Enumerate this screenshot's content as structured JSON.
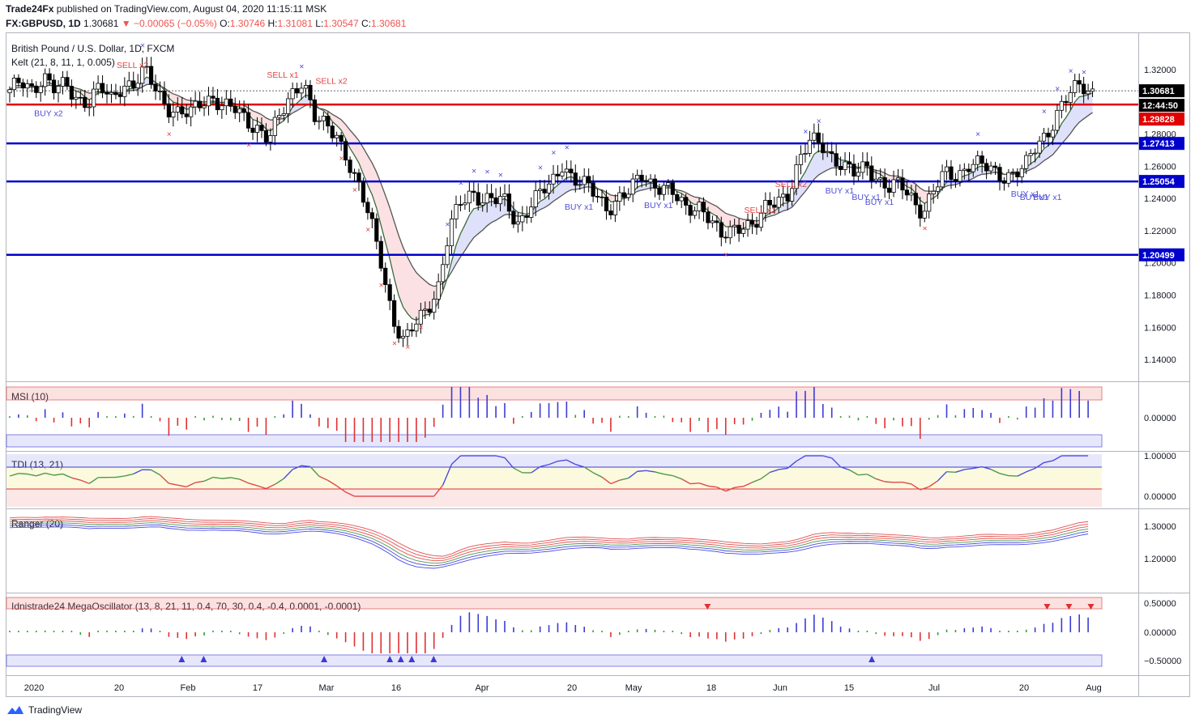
{
  "header": {
    "publisher": "Trade24Fx",
    "published_text": "published on TradingView.com, August 04, 2020 11:15:11 MSK",
    "symbol": "FX:GBPUSD, 1D",
    "last": "1.30681",
    "change": "−0.00065 (−0.05%)",
    "o_label": "O:",
    "o": "1.30746",
    "h_label": "H:",
    "h": "1.31081",
    "l_label": "L:",
    "l": "1.30547",
    "c_label": "C:",
    "c": "1.30681"
  },
  "pane_titles": {
    "main": "British Pound / U.S. Dollar, 1D, FXCM",
    "keltner": "Kelt (21, 8, 11, 1, 0.005)",
    "msi": "MSI (10)",
    "tdi": "TDI (13, 21)",
    "ranger": "Ranger (20)",
    "mega": "Idnistrade24 MegaOscillator (13, 8, 21, 11, 0.4, 70, 30, 0.4, -0.4, 0.0001, -0.0001)"
  },
  "price_badges": {
    "last": "1.30681",
    "countdown": "12:44:50",
    "red_level": "1.29828",
    "level1": "1.27413",
    "level2": "1.25054",
    "level3": "1.20499"
  },
  "colors": {
    "up": "#ffffff",
    "down": "#000000",
    "level_blue": "#0000cc",
    "level_red": "#e00000",
    "buy": "#4f4fd6",
    "sell": "#e04545",
    "grid_text": "#131722"
  },
  "chart_data": {
    "type": "candlestick",
    "title": "British Pound / U.S. Dollar, 1D, FXCM",
    "price_axis": {
      "ticks": [
        1.32,
        1.3,
        1.28,
        1.26,
        1.24,
        1.22,
        1.2,
        1.18,
        1.16,
        1.14
      ],
      "range": [
        1.128,
        1.334
      ]
    },
    "x_ticks": [
      "2020",
      "20",
      "Feb",
      "17",
      "Mar",
      "16",
      "Apr",
      "20",
      "May",
      "18",
      "Jun",
      "15",
      "Jul",
      "20",
      "Aug"
    ],
    "horizontal_levels": [
      {
        "value": 1.29828,
        "color": "red"
      },
      {
        "value": 1.27413,
        "color": "blue"
      },
      {
        "value": 1.25054,
        "color": "blue"
      },
      {
        "value": 1.20499,
        "color": "blue"
      }
    ],
    "close_path": [
      1.305,
      1.312,
      1.309,
      1.316,
      1.306,
      1.31,
      1.303,
      1.3,
      1.308,
      1.301,
      1.312,
      1.311,
      1.318,
      1.307,
      1.298,
      1.293,
      1.291,
      1.3,
      1.304,
      1.297,
      1.294,
      1.288,
      1.285,
      1.277,
      1.29,
      1.305,
      1.316,
      1.29,
      1.283,
      1.28,
      1.265,
      1.245,
      1.225,
      1.2,
      1.165,
      1.149,
      1.162,
      1.173,
      1.186,
      1.22,
      1.237,
      1.245,
      1.24,
      1.238,
      1.237,
      1.225,
      1.235,
      1.242,
      1.248,
      1.263,
      1.252,
      1.247,
      1.242,
      1.235,
      1.24,
      1.243,
      1.255,
      1.25,
      1.247,
      1.24,
      1.233,
      1.238,
      1.228,
      1.214,
      1.221,
      1.226,
      1.222,
      1.232,
      1.24,
      1.244,
      1.262,
      1.275,
      1.275,
      1.266,
      1.258,
      1.254,
      1.262,
      1.252,
      1.245,
      1.248,
      1.241,
      1.232,
      1.245,
      1.255,
      1.255,
      1.262,
      1.26,
      1.257,
      1.255,
      1.256,
      1.258,
      1.272,
      1.282,
      1.295,
      1.304,
      1.31,
      1.307
    ],
    "candles_per_day": 6,
    "indicators": {
      "msi": {
        "ticks": [
          "0.00000"
        ]
      },
      "tdi": {
        "ticks": [
          "1.00000",
          "0.00000"
        ]
      },
      "ranger": {
        "ticks": [
          "1.30000",
          "1.20000"
        ]
      },
      "mega": {
        "ticks": [
          "0.50000",
          "0.00000",
          "−0.50000"
        ]
      }
    }
  },
  "signals": {
    "buy": [
      "BUY x2",
      "BUY x1",
      "BUY x1",
      "BUY x1",
      "BUY x1",
      "BUY x1",
      "BUY x1",
      "BUY x1",
      "BUY x1"
    ],
    "sell": [
      "SELL x2",
      "SELL x1",
      "SELL x2",
      "SELL x2",
      "SELL x1"
    ]
  },
  "footer": {
    "brand": "TradingView"
  }
}
